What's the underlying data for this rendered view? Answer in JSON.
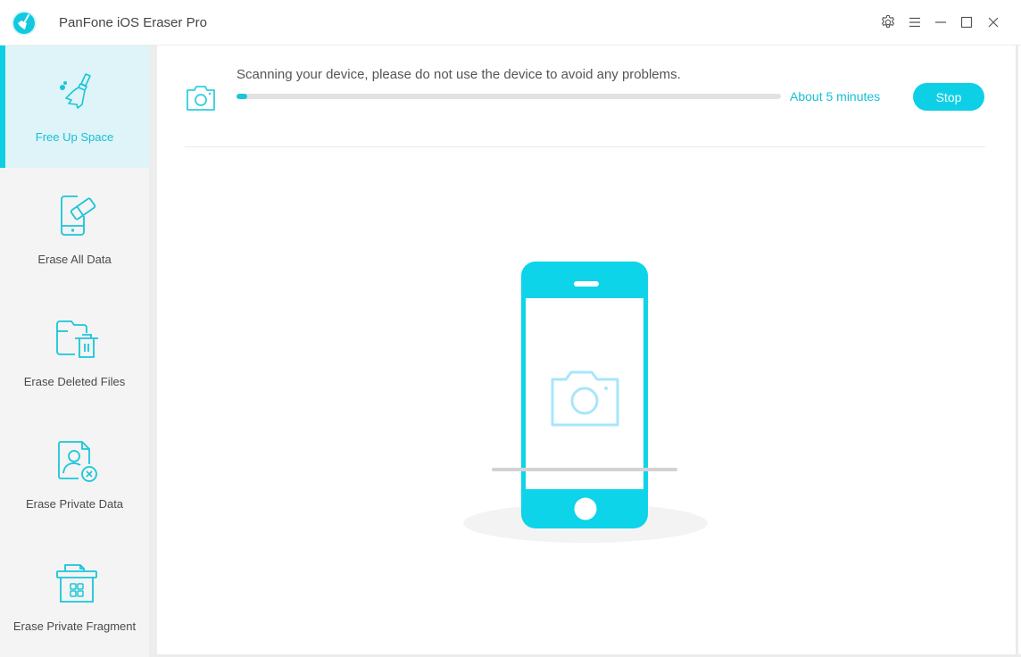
{
  "app": {
    "title": "PanFone iOS Eraser Pro",
    "logo_icon": "broom-logo-icon",
    "accent_color": "#0dd0e6"
  },
  "window_controls": [
    {
      "name": "settings-button",
      "icon": "gear-icon"
    },
    {
      "name": "menu-button",
      "icon": "hamburger-menu-icon"
    },
    {
      "name": "minimize-button",
      "icon": "minimize-icon"
    },
    {
      "name": "maximize-button",
      "icon": "maximize-icon"
    },
    {
      "name": "close-button",
      "icon": "close-icon"
    }
  ],
  "sidebar": {
    "items": [
      {
        "label": "Free Up Space",
        "icon": "broom-icon",
        "active": true
      },
      {
        "label": "Erase All Data",
        "icon": "phone-eraser-icon",
        "active": false
      },
      {
        "label": "Erase Deleted Files",
        "icon": "folder-trash-icon",
        "active": false
      },
      {
        "label": "Erase Private Data",
        "icon": "user-document-remove-icon",
        "active": false
      },
      {
        "label": "Erase Private Fragment",
        "icon": "fragment-bin-icon",
        "active": false
      }
    ]
  },
  "scan": {
    "icon": "camera-icon",
    "message": "Scanning your device, please do not use the device to avoid any problems.",
    "progress_percent": 2,
    "eta": "About 5 minutes",
    "stop_label": "Stop"
  },
  "illustration": {
    "icon": "phone-scanning-camera-icon"
  }
}
